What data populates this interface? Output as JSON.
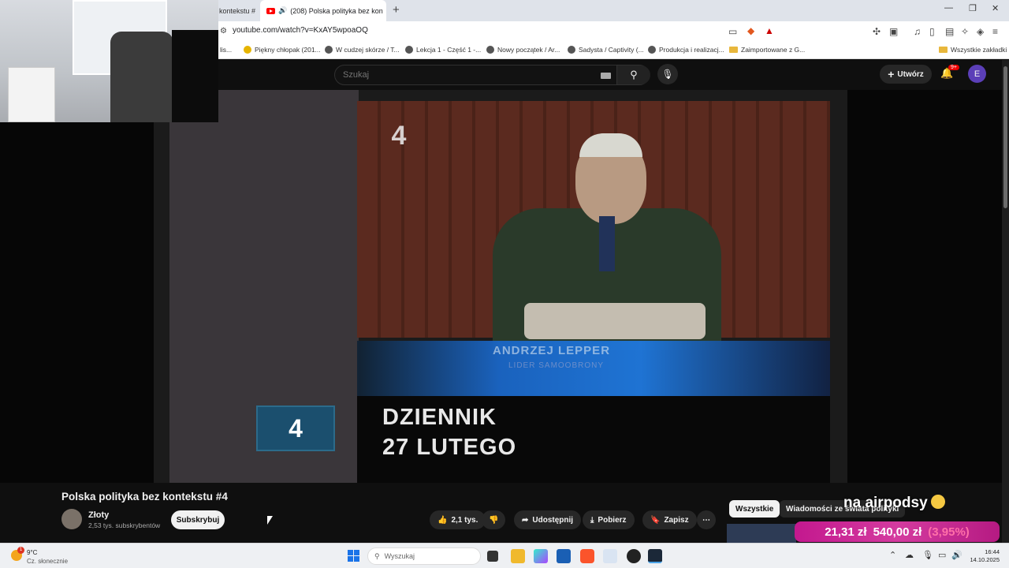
{
  "browser": {
    "tabs": [
      {
        "label": "kontekstu #"
      },
      {
        "label": "(208) Polska polityka bez kon"
      }
    ],
    "url": "youtube.com/watch?v=KxAY5wpoaOQ",
    "bookmarks": [
      {
        "label": "lis..."
      },
      {
        "label": "Piękny chłopak (201..."
      },
      {
        "label": "W cudzej skórze / T..."
      },
      {
        "label": "Lekcja 1 - Część 1 -..."
      },
      {
        "label": "Nowy początek / Ar..."
      },
      {
        "label": "Sadysta / Captivity (..."
      },
      {
        "label": "Produkcja i realizacj..."
      },
      {
        "label": "Zaimportowane z G..."
      },
      {
        "label": "Wszystkie zakładki"
      }
    ]
  },
  "youtube": {
    "search_placeholder": "Szukaj",
    "create_label": "Utwórz",
    "notifications_badge": "9+",
    "avatar_initial": "E"
  },
  "video": {
    "title": "Polska polityka bez kontekstu #4",
    "caption_line1": "ANDRZEJ LEPPER",
    "caption_line2": "LIDER SAMOOBRONY",
    "overlay": "DZIENNIK\n27 LUTEGO",
    "channel_logo": "4"
  },
  "channel": {
    "name": "Złoty",
    "subscribers": "2,53 tys. subskrybentów",
    "subscribe_label": "Subskrybuj"
  },
  "actions": {
    "likes": "2,1 tys.",
    "share": "Udostępnij",
    "download": "Pobierz",
    "save": "Zapisz"
  },
  "chips": {
    "all": "Wszystkie",
    "news": "Wiadomości ze świata polityki"
  },
  "stream_overlay": {
    "text": "na airpodsy",
    "ticker_a": "21,31 zł",
    "ticker_b": "540,00 zł",
    "ticker_pct": "(3,95%)"
  },
  "taskbar": {
    "temp": "9°C",
    "weather": "Cz. słonecznie",
    "weather_badge": "1",
    "search_placeholder": "Wyszukaj",
    "time": "16:44",
    "date": "14.10.2025"
  }
}
